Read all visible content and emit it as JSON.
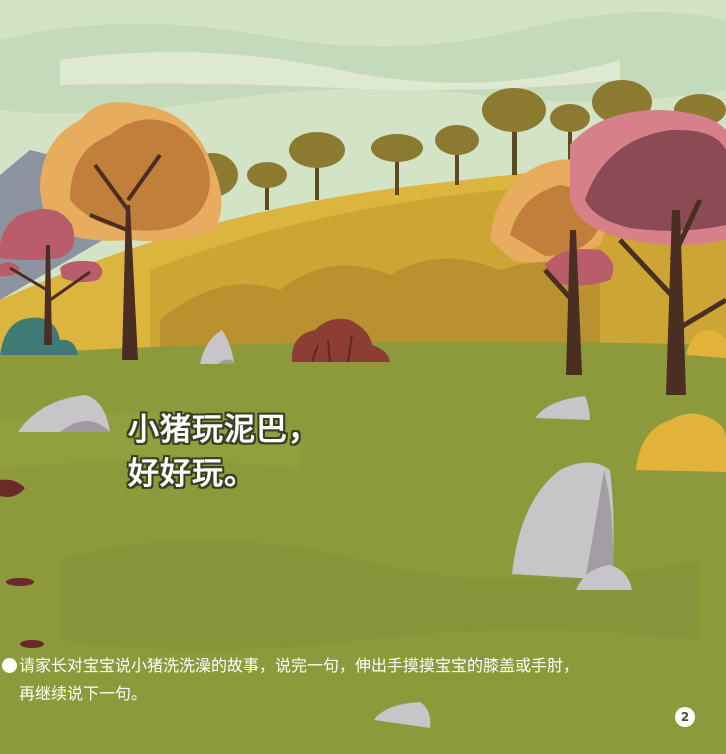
{
  "story": {
    "line1": "小猪玩泥巴，",
    "line2": "好好玩。"
  },
  "instruction": {
    "line1": "请家长对宝宝说小猪洗洗澡的故事，说完一句，伸出手摸摸宝宝的膝盖或手肘，",
    "line2": "再继续说下一句。"
  },
  "page_number": "2",
  "colors": {
    "sky": "#d3e3c6",
    "grass": "#8c9a3b",
    "hill": "#d6a93a",
    "trunk": "#4a2e22",
    "orange_tree": "#c4883f",
    "pink_tree": "#b95d6a",
    "rock": "#c8c5c8"
  }
}
